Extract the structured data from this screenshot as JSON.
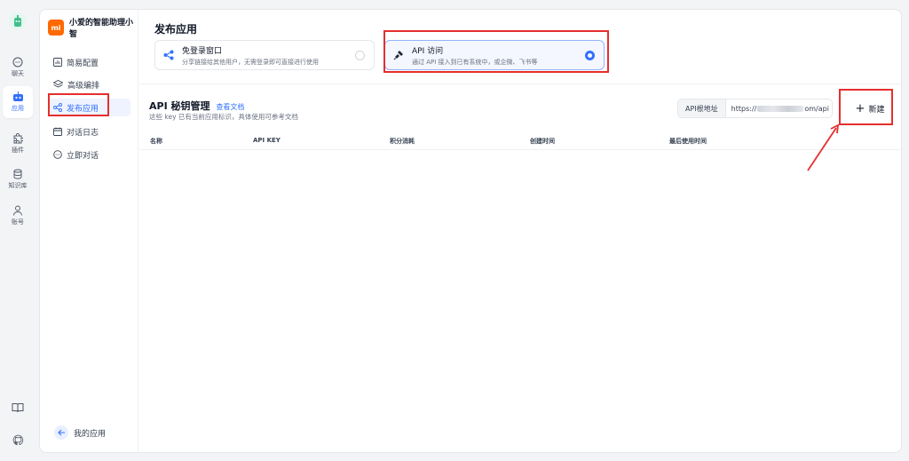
{
  "rail": {
    "items": [
      {
        "label": "聊天",
        "icon": "chat-icon"
      },
      {
        "label": "应用",
        "icon": "robot-icon"
      },
      {
        "label": "插件",
        "icon": "puzzle-icon"
      },
      {
        "label": "知识库",
        "icon": "database-icon"
      },
      {
        "label": "账号",
        "icon": "user-icon"
      }
    ],
    "active": "应用",
    "bottom_icons": [
      "book-icon",
      "github-icon"
    ]
  },
  "sidebar": {
    "app_avatar": "mi",
    "app_name": "小爱的智能助理小智",
    "items": [
      {
        "label": "简易配置",
        "icon": "bar-chart-icon"
      },
      {
        "label": "高级编排",
        "icon": "layers-icon"
      },
      {
        "label": "发布应用",
        "icon": "share-icon"
      },
      {
        "label": "对话日志",
        "icon": "calendar-icon"
      },
      {
        "label": "立即对话",
        "icon": "chat-bubble-icon"
      }
    ],
    "active": "发布应用",
    "back_label": "我的应用"
  },
  "publish": {
    "title": "发布应用",
    "options": [
      {
        "title": "免登录窗口",
        "desc": "分享链接给其他用户，无需登录即可直接进行使用",
        "icon": "share-nodes-icon",
        "selected": false
      },
      {
        "title": "API 访问",
        "desc": "通过 API 接入到已有系统中，或企微、飞书等",
        "icon": "plug-icon",
        "selected": true
      }
    ]
  },
  "api": {
    "title": "API 秘钥管理",
    "doc_link": "查看文档",
    "subtitle": "这些 key 已有当前应用标识，具体使用可参考文档",
    "base_url_label": "API根地址",
    "base_url_prefix": "https://",
    "base_url_suffix": "om/api",
    "new_button": "新建",
    "columns": [
      "名称",
      "API KEY",
      "积分消耗",
      "创建时间",
      "最后使用时间"
    ]
  },
  "colors": {
    "accent": "#3370ff",
    "annotation": "#e62e2e",
    "app_avatar": "#ff6900"
  }
}
